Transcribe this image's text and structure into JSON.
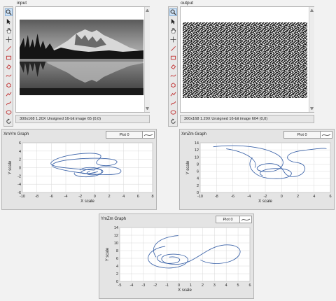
{
  "input_display": {
    "label": "input",
    "status": "300x168 1.20X Unsigned 16-bit image 65    (0,0)"
  },
  "output_display": {
    "label": "output",
    "status": "300x168 1.20X Unsigned 16-bit image 604    (0,0)"
  },
  "toolbar_icons": [
    "zoom-icon",
    "pointer-icon",
    "pan-hand-icon",
    "crosshair-icon",
    "line-tool-icon",
    "rectangle-tool-icon",
    "eraser-tool-icon",
    "freehand-tool-icon",
    "polygon-tool-icon",
    "broken-line-tool-icon",
    "freehand-line-tool-icon",
    "oval-tool-icon",
    "rotate-tool-icon"
  ],
  "graphs": [
    {
      "title": "XmYm Graph",
      "legend": "Plot 0",
      "xlabel": "X scale",
      "ylabel": "Y scale",
      "xticks": [
        "-10",
        "-8",
        "-6",
        "-4",
        "-2",
        "0",
        "2",
        "4",
        "6",
        "8"
      ],
      "yticks": [
        "6",
        "4",
        "2",
        "0",
        "-2",
        "-4",
        "-6"
      ]
    },
    {
      "title": "XmZm Graph",
      "legend": "Plot 0",
      "xlabel": "X scale",
      "ylabel": "Y scale",
      "xticks": [
        "-10",
        "-8",
        "-6",
        "-4",
        "-2",
        "0",
        "2",
        "4",
        "6"
      ],
      "yticks": [
        "14",
        "12",
        "10",
        "8",
        "6",
        "4",
        "2",
        "0"
      ]
    },
    {
      "title": "YmZm Graph",
      "legend": "Plot 0",
      "xlabel": "X scale",
      "ylabel": "Y scale",
      "xticks": [
        "-5",
        "-4",
        "-3",
        "-2",
        "-1",
        "0",
        "1",
        "2",
        "3",
        "4",
        "5",
        "6"
      ],
      "yticks": [
        "14",
        "12",
        "10",
        "8",
        "6",
        "4",
        "2",
        "0"
      ]
    }
  ],
  "colors": {
    "background": "#f2f2f2",
    "plot_line": "#3a62a8",
    "grid": "#d8d8d8",
    "frame": "#b5b5b5"
  }
}
